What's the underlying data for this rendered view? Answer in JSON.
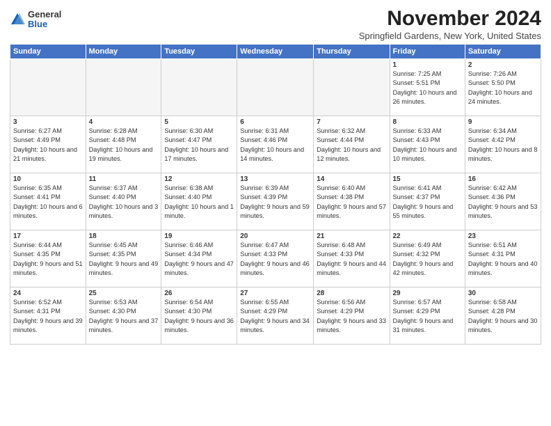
{
  "header": {
    "logo_general": "General",
    "logo_blue": "Blue",
    "month_title": "November 2024",
    "subtitle": "Springfield Gardens, New York, United States"
  },
  "weekdays": [
    "Sunday",
    "Monday",
    "Tuesday",
    "Wednesday",
    "Thursday",
    "Friday",
    "Saturday"
  ],
  "weeks": [
    [
      {
        "day": "",
        "info": ""
      },
      {
        "day": "",
        "info": ""
      },
      {
        "day": "",
        "info": ""
      },
      {
        "day": "",
        "info": ""
      },
      {
        "day": "",
        "info": ""
      },
      {
        "day": "1",
        "info": "Sunrise: 7:25 AM\nSunset: 5:51 PM\nDaylight: 10 hours and 26 minutes."
      },
      {
        "day": "2",
        "info": "Sunrise: 7:26 AM\nSunset: 5:50 PM\nDaylight: 10 hours and 24 minutes."
      }
    ],
    [
      {
        "day": "3",
        "info": "Sunrise: 6:27 AM\nSunset: 4:49 PM\nDaylight: 10 hours and 21 minutes."
      },
      {
        "day": "4",
        "info": "Sunrise: 6:28 AM\nSunset: 4:48 PM\nDaylight: 10 hours and 19 minutes."
      },
      {
        "day": "5",
        "info": "Sunrise: 6:30 AM\nSunset: 4:47 PM\nDaylight: 10 hours and 17 minutes."
      },
      {
        "day": "6",
        "info": "Sunrise: 6:31 AM\nSunset: 4:46 PM\nDaylight: 10 hours and 14 minutes."
      },
      {
        "day": "7",
        "info": "Sunrise: 6:32 AM\nSunset: 4:44 PM\nDaylight: 10 hours and 12 minutes."
      },
      {
        "day": "8",
        "info": "Sunrise: 6:33 AM\nSunset: 4:43 PM\nDaylight: 10 hours and 10 minutes."
      },
      {
        "day": "9",
        "info": "Sunrise: 6:34 AM\nSunset: 4:42 PM\nDaylight: 10 hours and 8 minutes."
      }
    ],
    [
      {
        "day": "10",
        "info": "Sunrise: 6:35 AM\nSunset: 4:41 PM\nDaylight: 10 hours and 6 minutes."
      },
      {
        "day": "11",
        "info": "Sunrise: 6:37 AM\nSunset: 4:40 PM\nDaylight: 10 hours and 3 minutes."
      },
      {
        "day": "12",
        "info": "Sunrise: 6:38 AM\nSunset: 4:40 PM\nDaylight: 10 hours and 1 minute."
      },
      {
        "day": "13",
        "info": "Sunrise: 6:39 AM\nSunset: 4:39 PM\nDaylight: 9 hours and 59 minutes."
      },
      {
        "day": "14",
        "info": "Sunrise: 6:40 AM\nSunset: 4:38 PM\nDaylight: 9 hours and 57 minutes."
      },
      {
        "day": "15",
        "info": "Sunrise: 6:41 AM\nSunset: 4:37 PM\nDaylight: 9 hours and 55 minutes."
      },
      {
        "day": "16",
        "info": "Sunrise: 6:42 AM\nSunset: 4:36 PM\nDaylight: 9 hours and 53 minutes."
      }
    ],
    [
      {
        "day": "17",
        "info": "Sunrise: 6:44 AM\nSunset: 4:35 PM\nDaylight: 9 hours and 51 minutes."
      },
      {
        "day": "18",
        "info": "Sunrise: 6:45 AM\nSunset: 4:35 PM\nDaylight: 9 hours and 49 minutes."
      },
      {
        "day": "19",
        "info": "Sunrise: 6:46 AM\nSunset: 4:34 PM\nDaylight: 9 hours and 47 minutes."
      },
      {
        "day": "20",
        "info": "Sunrise: 6:47 AM\nSunset: 4:33 PM\nDaylight: 9 hours and 46 minutes."
      },
      {
        "day": "21",
        "info": "Sunrise: 6:48 AM\nSunset: 4:33 PM\nDaylight: 9 hours and 44 minutes."
      },
      {
        "day": "22",
        "info": "Sunrise: 6:49 AM\nSunset: 4:32 PM\nDaylight: 9 hours and 42 minutes."
      },
      {
        "day": "23",
        "info": "Sunrise: 6:51 AM\nSunset: 4:31 PM\nDaylight: 9 hours and 40 minutes."
      }
    ],
    [
      {
        "day": "24",
        "info": "Sunrise: 6:52 AM\nSunset: 4:31 PM\nDaylight: 9 hours and 39 minutes."
      },
      {
        "day": "25",
        "info": "Sunrise: 6:53 AM\nSunset: 4:30 PM\nDaylight: 9 hours and 37 minutes."
      },
      {
        "day": "26",
        "info": "Sunrise: 6:54 AM\nSunset: 4:30 PM\nDaylight: 9 hours and 36 minutes."
      },
      {
        "day": "27",
        "info": "Sunrise: 6:55 AM\nSunset: 4:29 PM\nDaylight: 9 hours and 34 minutes."
      },
      {
        "day": "28",
        "info": "Sunrise: 6:56 AM\nSunset: 4:29 PM\nDaylight: 9 hours and 33 minutes."
      },
      {
        "day": "29",
        "info": "Sunrise: 6:57 AM\nSunset: 4:29 PM\nDaylight: 9 hours and 31 minutes."
      },
      {
        "day": "30",
        "info": "Sunrise: 6:58 AM\nSunset: 4:28 PM\nDaylight: 9 hours and 30 minutes."
      }
    ]
  ]
}
